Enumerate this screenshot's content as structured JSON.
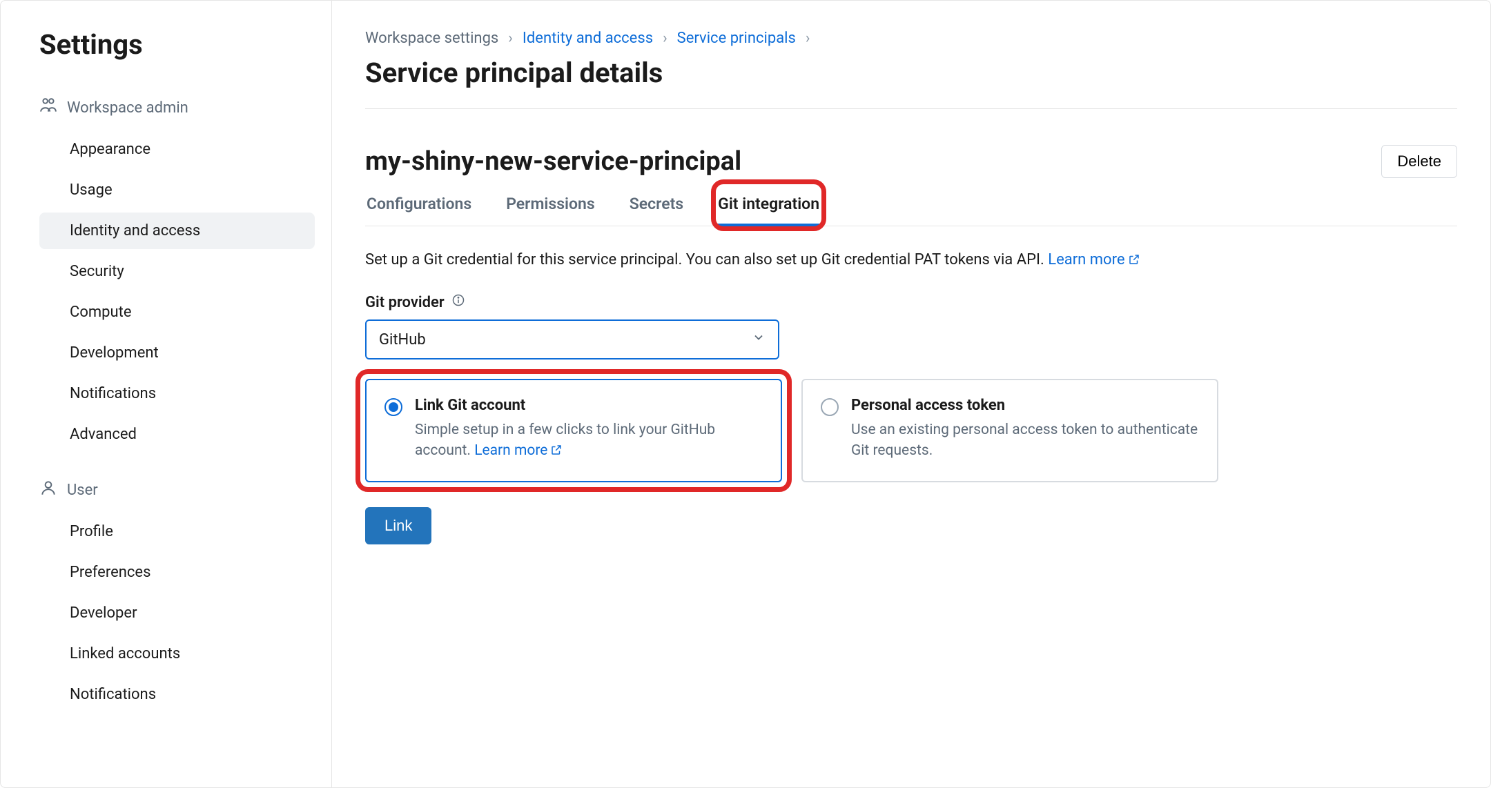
{
  "sidebar": {
    "title": "Settings",
    "sections": [
      {
        "header": "Workspace admin",
        "items": [
          "Appearance",
          "Usage",
          "Identity and access",
          "Security",
          "Compute",
          "Development",
          "Notifications",
          "Advanced"
        ],
        "active_index": 2
      },
      {
        "header": "User",
        "items": [
          "Profile",
          "Preferences",
          "Developer",
          "Linked accounts",
          "Notifications"
        ],
        "active_index": -1
      }
    ]
  },
  "breadcrumb": {
    "items": [
      "Workspace settings",
      "Identity and access",
      "Service principals"
    ]
  },
  "page": {
    "title": "Service principal details",
    "sp_name": "my-shiny-new-service-principal",
    "delete_label": "Delete"
  },
  "tabs": {
    "items": [
      "Configurations",
      "Permissions",
      "Secrets",
      "Git integration"
    ],
    "active_index": 3
  },
  "git": {
    "description_prefix": "Set up a Git credential for this service principal. You can also set up Git credential PAT tokens via API. ",
    "learn_more": "Learn more",
    "provider_label": "Git provider",
    "provider_value": "GitHub",
    "options": [
      {
        "title": "Link Git account",
        "desc_prefix": "Simple setup in a few clicks to link your GitHub account. ",
        "learn_more": "Learn more"
      },
      {
        "title": "Personal access token",
        "desc": "Use an existing personal access token to authenticate Git requests."
      }
    ],
    "selected_option": 0,
    "link_button": "Link"
  }
}
